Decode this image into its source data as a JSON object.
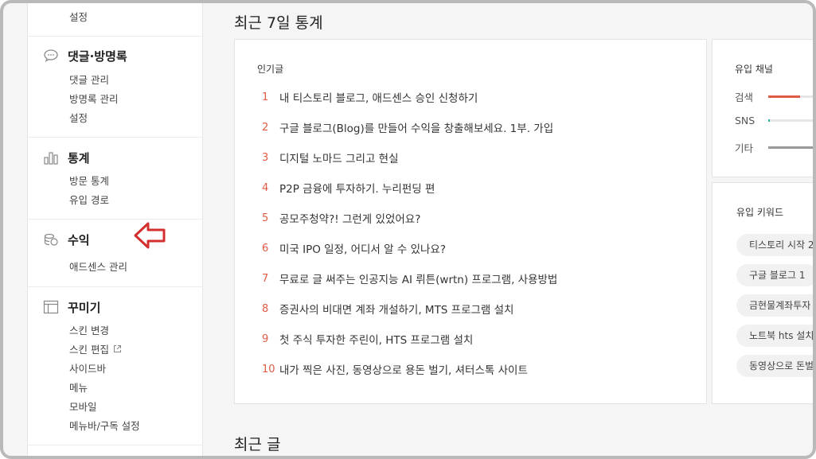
{
  "sidebar": {
    "top_item": "설정",
    "groups": [
      {
        "title": "댓글·방명록",
        "icon": "speech-bubble-icon",
        "items": [
          "댓글 관리",
          "방명록 관리",
          "설정"
        ]
      },
      {
        "title": "통계",
        "icon": "bar-chart-icon",
        "items": [
          "방문 통계",
          "유입 경로"
        ]
      },
      {
        "title": "수익",
        "icon": "coins-icon",
        "items": [
          "애드센스 관리"
        ]
      },
      {
        "title": "꾸미기",
        "icon": "layout-icon",
        "items": [
          "스킨 변경",
          "스킨 편집",
          "사이드바",
          "메뉴",
          "모바일",
          "메뉴바/구독 설정"
        ]
      }
    ]
  },
  "main": {
    "stats_title": "최근 7일 통계",
    "popular": {
      "label": "인기글",
      "posts": [
        {
          "rank": "1",
          "title": "내 티스토리 블로그, 애드센스 승인 신청하기"
        },
        {
          "rank": "2",
          "title": "구글 블로그(Blog)를 만들어 수익을 창출해보세요. 1부. 가입"
        },
        {
          "rank": "3",
          "title": "디지털 노마드 그리고 현실"
        },
        {
          "rank": "4",
          "title": "P2P 금융에 투자하기. 누리펀딩 편"
        },
        {
          "rank": "5",
          "title": "공모주청약?! 그런게 있었어요?"
        },
        {
          "rank": "6",
          "title": "미국 IPO 일정, 어디서 알 수 있나요?"
        },
        {
          "rank": "7",
          "title": "무료로 글 써주는 인공지능 AI 뤼튼(wrtn) 프로그램, 사용방법"
        },
        {
          "rank": "8",
          "title": "증권사의 비대면 계좌 개설하기, MTS 프로그램 설치"
        },
        {
          "rank": "9",
          "title": "첫 주식 투자한 주린이, HTS 프로그램 설치"
        },
        {
          "rank": "10",
          "title": "내가 찍은 사진, 동영상으로 용돈 벌기, 셔터스톡 사이트"
        }
      ]
    },
    "channels": {
      "label": "유입 채널",
      "items": [
        {
          "name": "검색",
          "share": 0.4,
          "color": "#e05b44"
        },
        {
          "name": "SNS",
          "share": 0.02,
          "color": "#2bb5a0"
        },
        {
          "name": "기타",
          "share": 0.6,
          "color": "#999999"
        }
      ]
    },
    "keywords": {
      "label": "유입 키워드",
      "items": [
        "티스토리 시작  2",
        "구글 블로그  1",
        "금현물계좌투자",
        "노트북 hts 설치",
        "동영상으로 돈벌"
      ]
    },
    "recent_title": "최근 글"
  },
  "colors": {
    "accent": "#e05b44",
    "arrow": "#d32f2f"
  }
}
